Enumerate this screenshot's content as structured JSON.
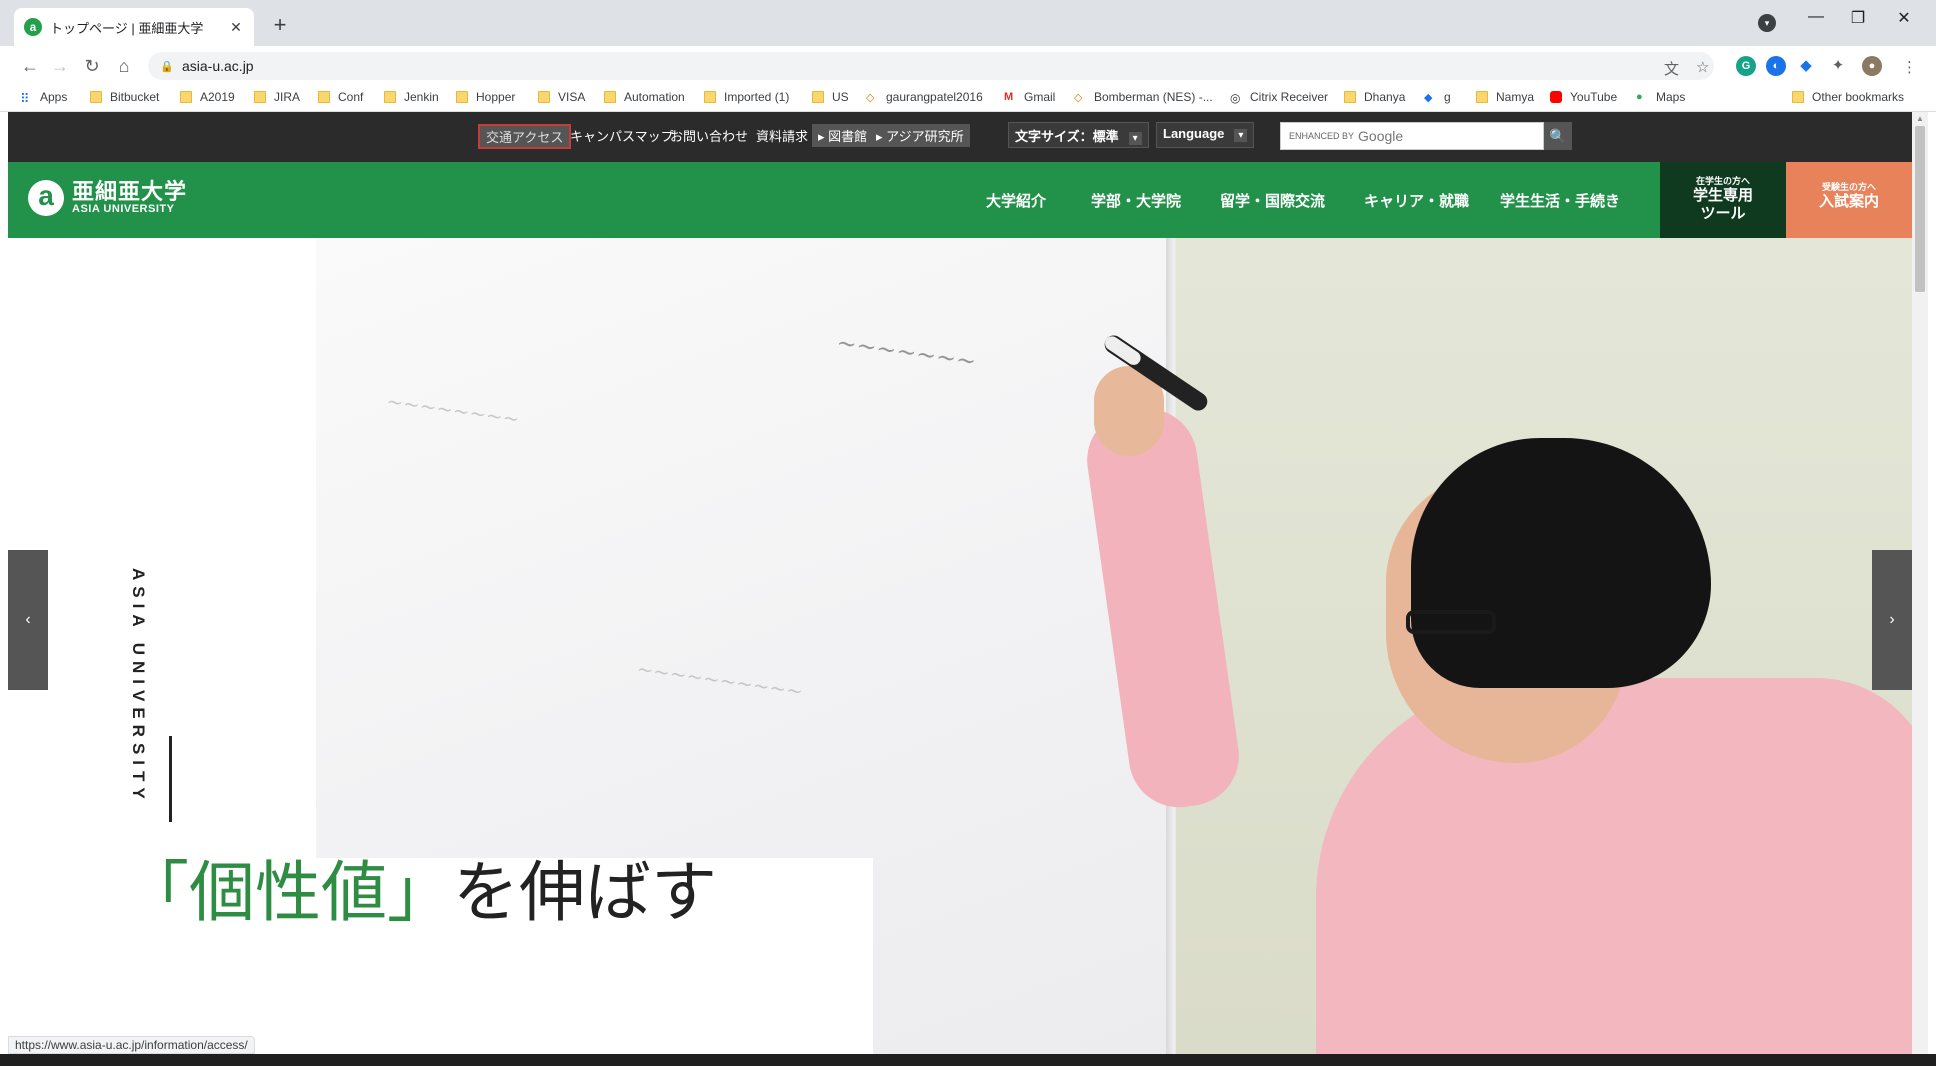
{
  "browser": {
    "tab_title": "トップページ | 亜細亜大学",
    "tab_favicon": "a",
    "tab_close": "✕",
    "new_tab": "+",
    "url": "asia-u.ac.jp",
    "controls": {
      "minimize": "—",
      "restore": "❐",
      "close": "✕"
    }
  },
  "bookmarks": [
    {
      "label": "Apps",
      "icon": "apps-grid-icon"
    },
    {
      "label": "Bitbucket",
      "icon": "folder-icon"
    },
    {
      "label": "A2019",
      "icon": "folder-icon"
    },
    {
      "label": "JIRA",
      "icon": "folder-icon"
    },
    {
      "label": "Conf",
      "icon": "folder-icon"
    },
    {
      "label": "Jenkin",
      "icon": "folder-icon"
    },
    {
      "label": "Hopper",
      "icon": "folder-icon"
    },
    {
      "label": "VISA",
      "icon": "folder-icon"
    },
    {
      "label": "Automation",
      "icon": "folder-icon"
    },
    {
      "label": "Imported (1)",
      "icon": "folder-icon"
    },
    {
      "label": "US",
      "icon": "folder-icon"
    },
    {
      "label": "gaurangpatel2016",
      "icon": "site-icon"
    },
    {
      "label": "Gmail",
      "icon": "gmail-icon"
    },
    {
      "label": "Bomberman (NES) -...",
      "icon": "site-icon"
    },
    {
      "label": "Citrix Receiver",
      "icon": "citrix-icon"
    },
    {
      "label": "Dhanya",
      "icon": "folder-icon"
    },
    {
      "label": "g",
      "icon": "diamond-icon"
    },
    {
      "label": "Namya",
      "icon": "folder-icon"
    },
    {
      "label": "YouTube",
      "icon": "youtube-icon"
    },
    {
      "label": "Maps",
      "icon": "maps-icon"
    }
  ],
  "other_bookmarks": "Other bookmarks",
  "site": {
    "util_links": [
      "交通アクセス",
      "キャンパスマップ",
      "お問い合わせ",
      "資料請求"
    ],
    "library_link": "▸ 図書館",
    "institute_link": "▸ アジア研究所",
    "font_size": "文字サイズ：標準",
    "language": "Language",
    "dropdown_arrow": "▾",
    "search_prefix": "ENHANCED BY",
    "search_brand": "Google",
    "search_button": "🔍",
    "logo_mark": "a",
    "logo_jp": "亜細亜大学",
    "logo_en": "ASIA UNIVERSITY",
    "main_nav": [
      "大学紹介",
      "学部・大学院",
      "留学・国際交流",
      "キャリア・就職",
      "学生生活・手続き"
    ],
    "student_small": "在学生の方へ",
    "student_line1": "学生専用",
    "student_line2": "ツール",
    "exam_small": "受験生の方へ",
    "exam_label": "入試案内",
    "hero_vertical": "ASIA UNIVERSITY",
    "tagline_green": "「個性値」",
    "tagline_rest": "を伸ばす",
    "prev": "‹",
    "next": "›"
  },
  "status_url": "https://www.asia-u.ac.jp/information/access/",
  "colors": {
    "brand_green": "#22914a",
    "student_dark": "#0f3a1f",
    "exam_orange": "#e8825a",
    "util_bar": "#2b2b2b"
  }
}
